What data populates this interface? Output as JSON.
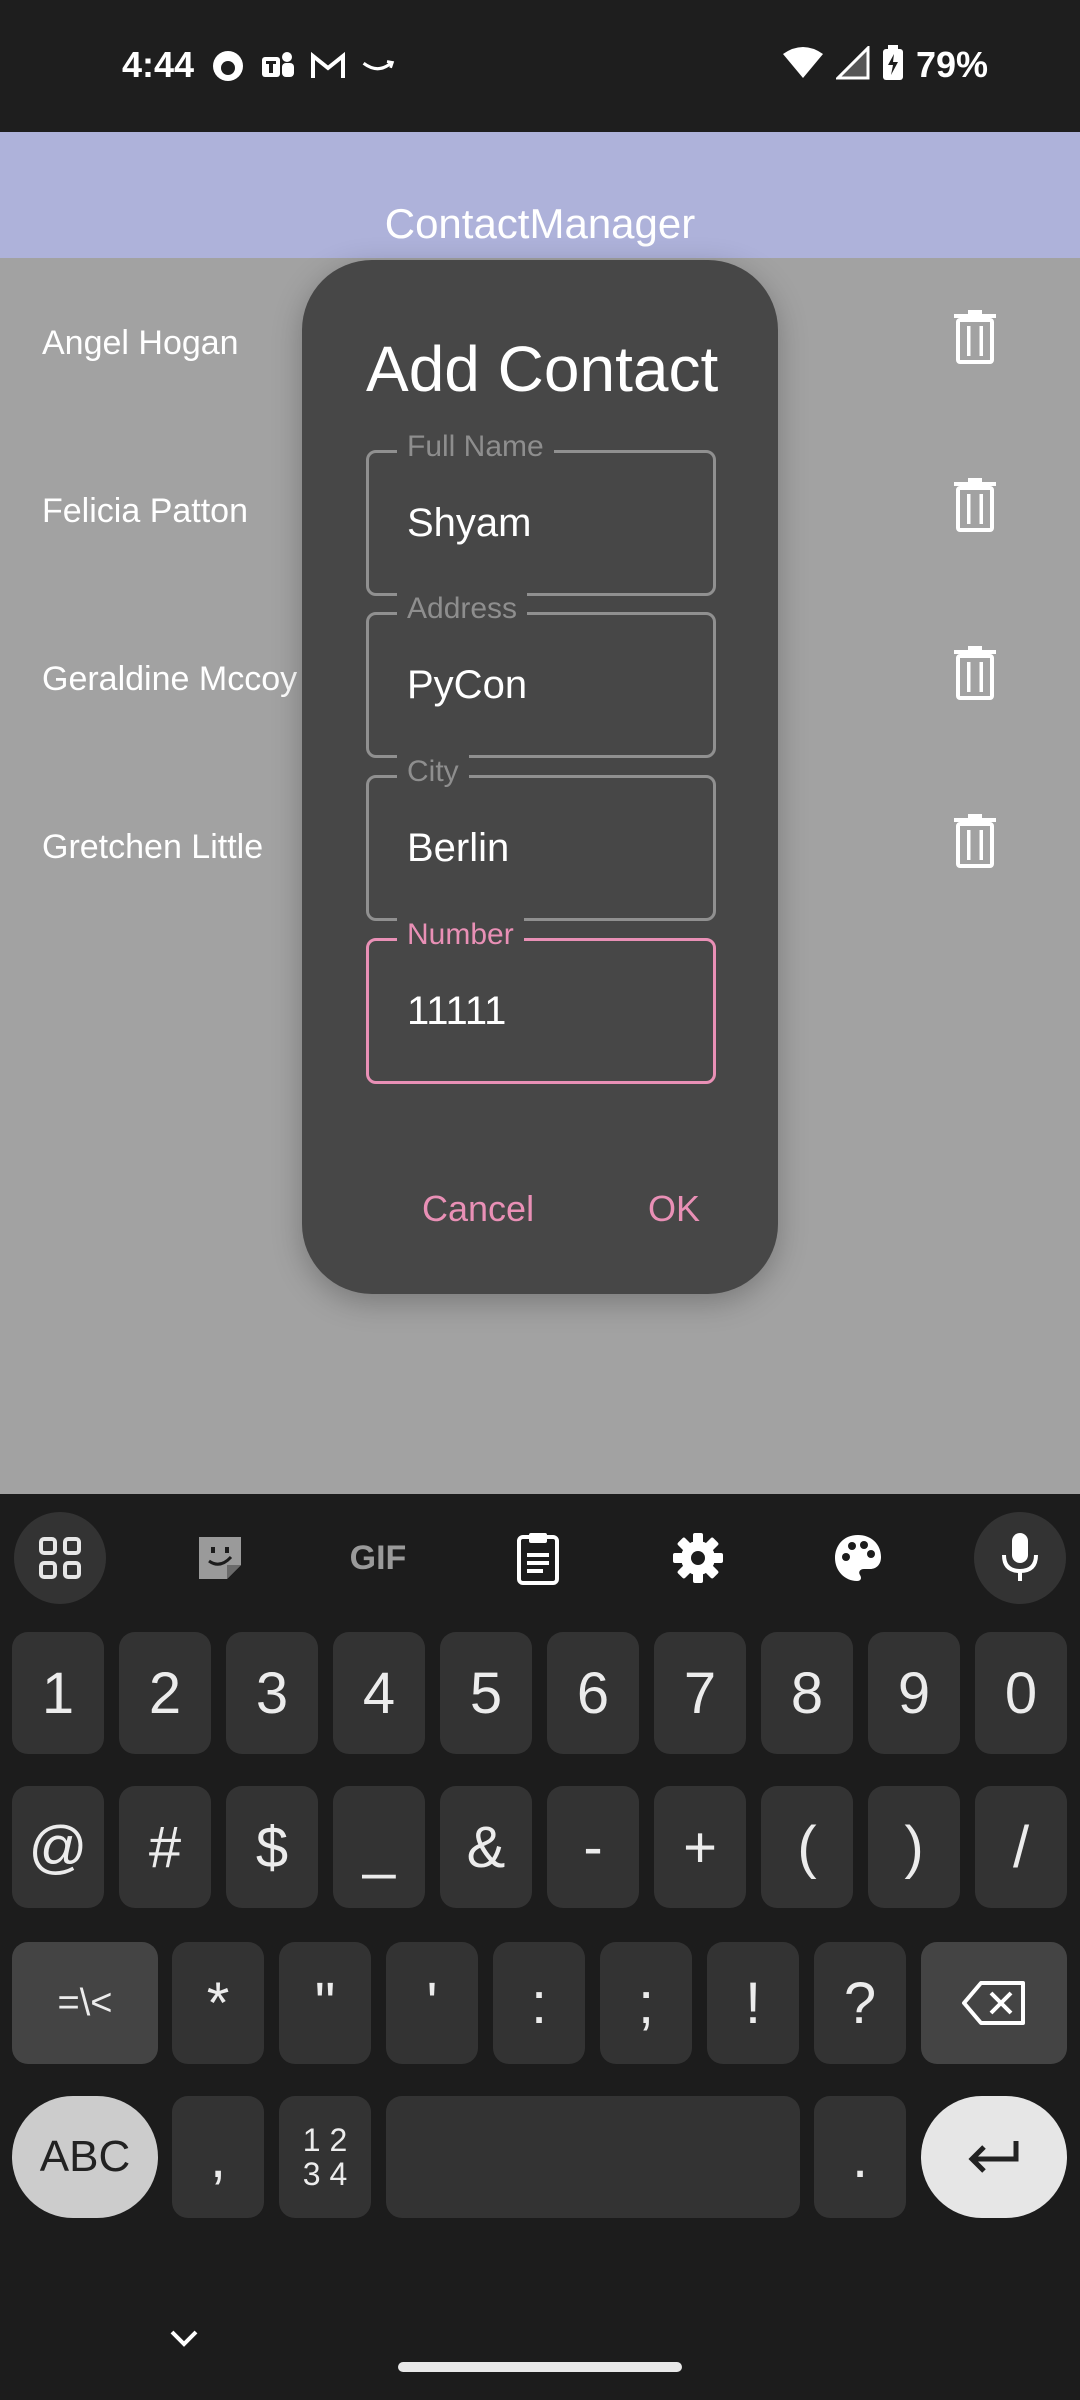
{
  "status_bar": {
    "time": "4:44",
    "battery": "79%",
    "left_icons": [
      "github-icon",
      "teams-icon",
      "gmail-icon",
      "amazon-icon"
    ],
    "right_icons": [
      "wifi-icon",
      "signal-icon",
      "battery-charging-icon"
    ]
  },
  "app": {
    "title": "ContactManager",
    "contacts": [
      {
        "name": "Angel Hogan"
      },
      {
        "name": "Felicia Patton"
      },
      {
        "name": "Geraldine Mccoy"
      },
      {
        "name": "Gretchen Little"
      }
    ]
  },
  "dialog": {
    "title": "Add Contact",
    "fields": [
      {
        "label": "Full Name",
        "value": "Shyam"
      },
      {
        "label": "Address",
        "value": "PyCon"
      },
      {
        "label": "City",
        "value": "Berlin"
      },
      {
        "label": "Number",
        "value": "11111"
      }
    ],
    "cancel_label": "Cancel",
    "ok_label": "OK",
    "accent_color": "#e990b6"
  },
  "keyboard": {
    "toolbar": [
      "apps-grid-icon",
      "sticker-icon",
      "gif-icon",
      "clipboard-icon",
      "settings-gear-icon",
      "palette-icon",
      "microphone-icon"
    ],
    "gif_label": "GIF",
    "row1": [
      "1",
      "2",
      "3",
      "4",
      "5",
      "6",
      "7",
      "8",
      "9",
      "0"
    ],
    "row2": [
      "@",
      "#",
      "$",
      "_",
      "&",
      "-",
      "+",
      "(",
      ")",
      "/"
    ],
    "row3": [
      "=\\<",
      "*",
      "\"",
      "'",
      ":",
      ";",
      "!",
      "?"
    ],
    "abc_label": "ABC",
    "comma": ",",
    "numpad_label_top": "1 2",
    "numpad_label_bottom": "3 4",
    "period": "."
  }
}
